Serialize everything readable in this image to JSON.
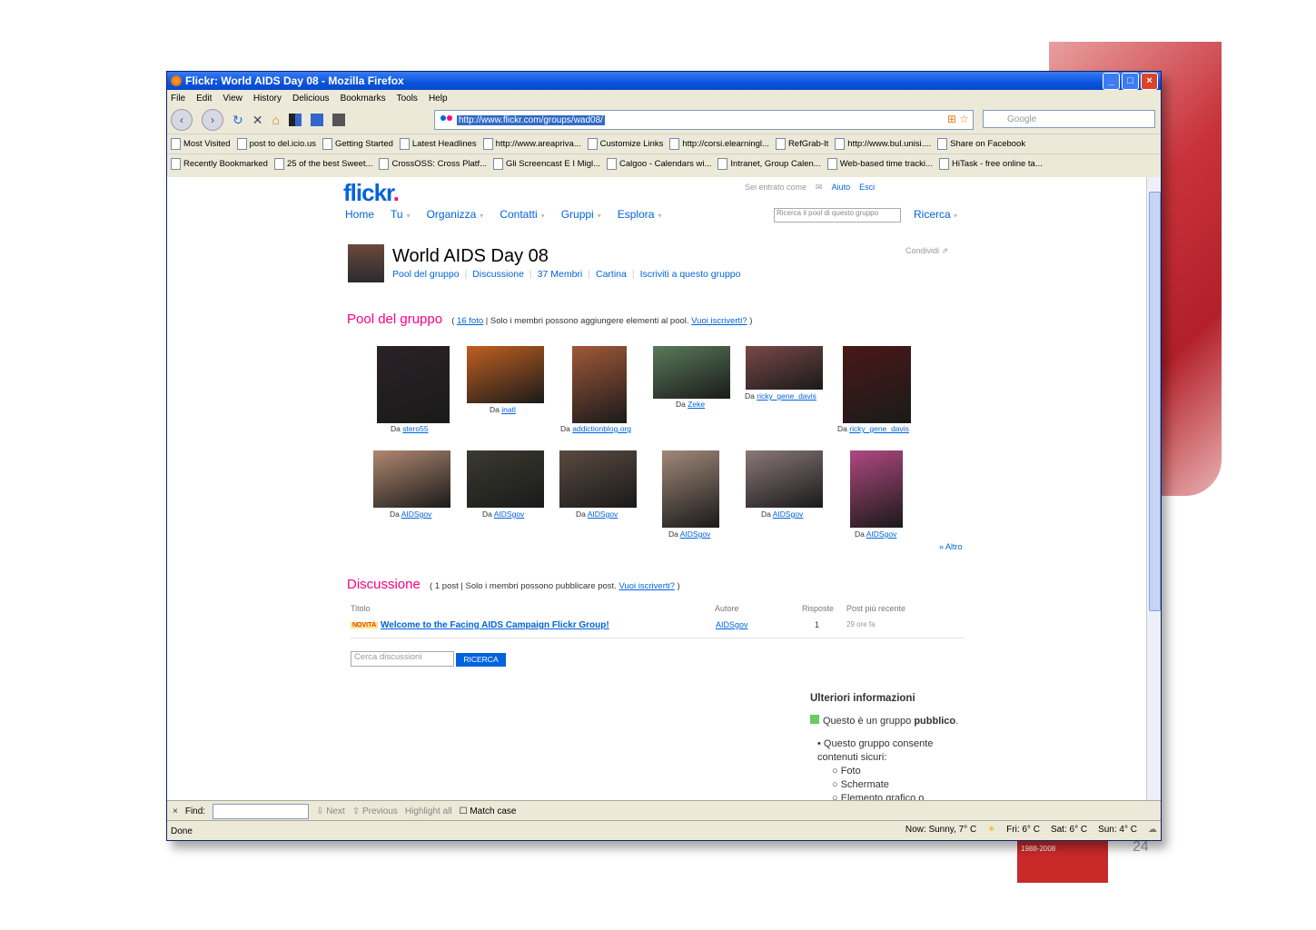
{
  "slide": {
    "page_number": "24",
    "logo_text": "1988-2008"
  },
  "window": {
    "title": "Flickr: World AIDS Day 08 - Mozilla Firefox",
    "menu": [
      "File",
      "Edit",
      "View",
      "History",
      "Delicious",
      "Bookmarks",
      "Tools",
      "Help"
    ],
    "url": "http://www.flickr.com/groups/wad08/",
    "search_placeholder": "Google",
    "bookmarks_row1": [
      "Most Visited",
      "post to del.icio.us",
      "Getting Started",
      "Latest Headlines",
      "http://www.areapriva...",
      "Customize Links",
      "http://corsi.elearningl...",
      "RefGrab-It",
      "http://www.bul.unisi....",
      "Share on Facebook"
    ],
    "bookmarks_row2": [
      "Recently Bookmarked",
      "25 of the best Sweet...",
      "CrossOSS: Cross Platf...",
      "Gli Screencast E I Migl...",
      "Calgoo - Calendars wi...",
      "Intranet, Group Calen...",
      "Web-based time tracki...",
      "HiTask - free online ta..."
    ],
    "find": {
      "label": "Find:",
      "next": "Next",
      "previous": "Previous",
      "highlight": "Highlight all",
      "match_case": "Match case"
    },
    "status": "Done",
    "weather": [
      "Now: Sunny, 7° C",
      "Fri: 6° C",
      "Sat: 6° C",
      "Sun: 4° C"
    ]
  },
  "flickr": {
    "logo_main": "flickr",
    "logo_dot": ".",
    "signed_in": "Sei entrato come",
    "help": "Aiuto",
    "exit": "Esci",
    "nav": [
      "Home",
      "Tu",
      "Organizza",
      "Contatti",
      "Gruppi",
      "Esplora"
    ],
    "search_placeholder": "Ricerca il pool di questo gruppo",
    "search_button": "Ricerca",
    "group_title": "World AIDS Day 08",
    "share": "Condividi",
    "sublinks": [
      "Pool del gruppo",
      "Discussione",
      "37 Membri",
      "Cartina",
      "Iscriviti a questo gruppo"
    ],
    "pool": {
      "heading": "Pool del gruppo",
      "count_link": "16 foto",
      "note": "Solo i membri possono aggiungere elementi al pool.",
      "join_link": "Vuoi iscriverti?",
      "photos": [
        {
          "by": "Da",
          "user": "stero55",
          "color": "#2a2226"
        },
        {
          "by": "Da",
          "user": "inatl",
          "color": "#c06020"
        },
        {
          "by": "Da",
          "user": "addictionblog.org",
          "color": "#a05838"
        },
        {
          "by": "Da",
          "user": "Zeke",
          "color": "#5a7a5a"
        },
        {
          "by": "Da",
          "user": "ricky_gene_davis",
          "color": "#7a4848"
        },
        {
          "by": "Da",
          "user": "ricky_gene_davis",
          "color": "#4a1818"
        },
        {
          "by": "Da",
          "user": "AIDSgov",
          "color": "#b08870"
        },
        {
          "by": "Da",
          "user": "AIDSgov",
          "color": "#3a3a30"
        },
        {
          "by": "Da",
          "user": "AIDSgov",
          "color": "#5a4a40"
        },
        {
          "by": "Da",
          "user": "AIDSgov",
          "color": "#a08878"
        },
        {
          "by": "Da",
          "user": "AIDSgov",
          "color": "#8a7878"
        },
        {
          "by": "Da",
          "user": "AIDSgov",
          "color": "#b04880"
        }
      ],
      "more": "» Altro"
    },
    "discussion": {
      "heading": "Discussione",
      "count": "1 post",
      "note": "Solo i membri possono pubblicare post.",
      "join_link": "Vuoi iscriverti?",
      "columns": [
        "Titolo",
        "Autore",
        "Risposte",
        "Post più recente"
      ],
      "rows": [
        {
          "badge": "NOVITÀ",
          "title": "Welcome to the Facing AIDS Campaign Flickr Group!",
          "author": "AIDSgov",
          "replies": "1",
          "latest": "29 ore fa"
        }
      ],
      "search_placeholder": "Cerca discussioni",
      "search_button": "RICERCA"
    },
    "info": {
      "heading": "Ulteriori informazioni",
      "public": "Questo è un gruppo",
      "public_bold": "pubblico",
      "safe": "Questo gruppo consente contenuti sicuri:",
      "types": [
        "Foto",
        "Schermate",
        "Elemento grafico o"
      ]
    }
  }
}
